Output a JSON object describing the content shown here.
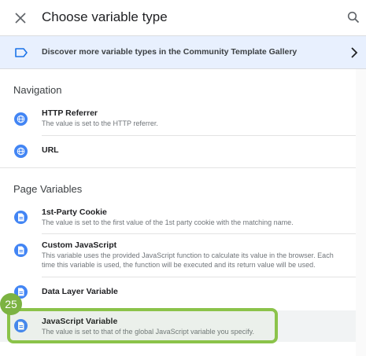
{
  "header": {
    "title": "Choose variable type",
    "close_icon": "close-icon",
    "search_icon": "search-icon"
  },
  "banner": {
    "text": "Discover more variable types in the Community Template Gallery",
    "icon": "label-tag-icon",
    "chevron": "chevron-right-icon"
  },
  "sections": [
    {
      "title": "Navigation",
      "items": [
        {
          "name": "HTTP Referrer",
          "description": "The value is set to the HTTP referrer.",
          "icon": "globe-icon"
        },
        {
          "name": "URL",
          "description": "",
          "icon": "globe-icon"
        }
      ]
    },
    {
      "title": "Page Variables",
      "items": [
        {
          "name": "1st-Party Cookie",
          "description": "The value is set to the first value of the 1st party cookie with the matching name.",
          "icon": "document-icon"
        },
        {
          "name": "Custom JavaScript",
          "description": "This variable uses the provided JavaScript function to calculate its value in the browser. Each time this variable is used, the function will be executed and its return value will be used.",
          "icon": "document-icon"
        },
        {
          "name": "Data Layer Variable",
          "description": "",
          "icon": "document-icon"
        },
        {
          "name": "JavaScript Variable",
          "description": "The value is set to that of the global JavaScript variable you specify.",
          "icon": "document-icon"
        }
      ]
    }
  ],
  "annotation": {
    "step_number": "25"
  },
  "colors": {
    "accent": "#4285f4",
    "banner_bg": "#e8f0fe",
    "highlight": "#8bc34a"
  }
}
